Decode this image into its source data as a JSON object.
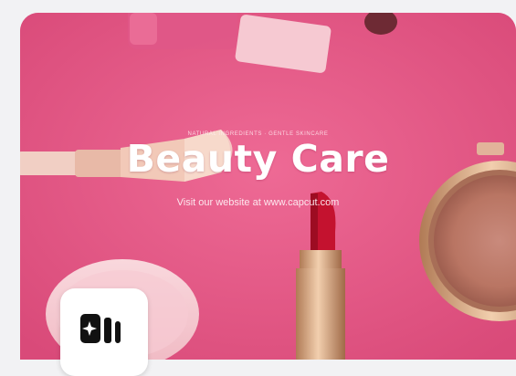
{
  "template": {
    "subtitle": "NATURAL INGREDIENTS · GENTLE SKINCARE",
    "title": "Beauty Care",
    "caption": "Visit our website at www.capcut.com"
  },
  "badge": {
    "icon": "capcut-template-icon"
  },
  "colors": {
    "background": "#e45a86",
    "title": "#ffffff",
    "lipstick": "#c4122f"
  }
}
